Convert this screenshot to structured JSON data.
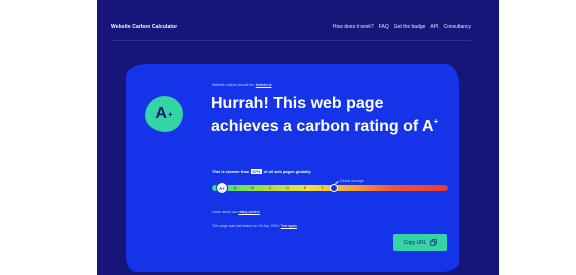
{
  "header": {
    "brand": "Website Carbon Calculator",
    "nav": [
      "How does it work?",
      "FAQ",
      "Get the badge",
      "API",
      "Consultancy"
    ]
  },
  "result": {
    "kicker_prefix": "Website carbon results for:",
    "kicker_url": "thebrief.ai",
    "badge_grade": "A",
    "badge_sup": "+",
    "title_text": "Hurrah! This web page achieves a carbon rating of A",
    "title_sup": "+",
    "cleaner_prefix": "This is cleaner than",
    "cleaner_percent": "97%",
    "cleaner_suffix": "of all web pages globally",
    "scale": {
      "marker_label": "A+",
      "grades": [
        "A",
        "B",
        "C",
        "D",
        "E",
        "F"
      ],
      "average_label": "Global average"
    },
    "learn_prefix": "Learn about our",
    "learn_link": "rating system",
    "tested_prefix": "This page was last tested on 19 Apr, 2024.",
    "tested_link": "Test again",
    "copy_label": "Copy URL"
  },
  "colors": {
    "page_bg": "#15157a",
    "card": "#1533e8",
    "accent": "#35d4a7"
  },
  "icons": {
    "copy": "copy-icon"
  }
}
